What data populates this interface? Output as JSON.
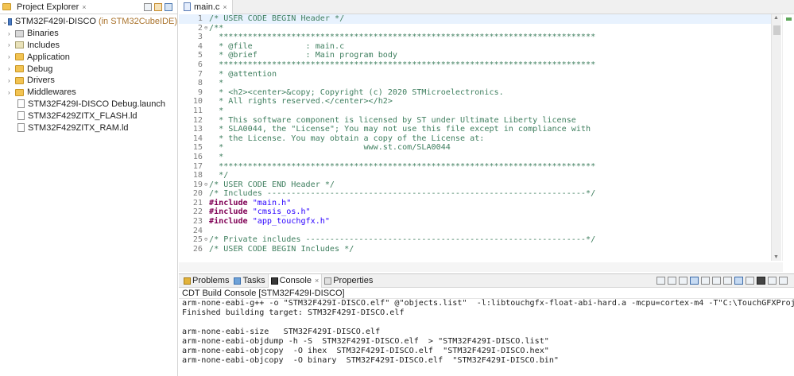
{
  "project_explorer": {
    "title": "Project Explorer",
    "close_glyph": "×",
    "project": {
      "name": "STM32F429I-DISCO",
      "hint": "(in STM32CubeIDE)"
    },
    "folders": [
      {
        "label": "Binaries",
        "icon": "binaries-icon"
      },
      {
        "label": "Includes",
        "icon": "includes-icon"
      },
      {
        "label": "Application",
        "icon": "folder-icon"
      },
      {
        "label": "Debug",
        "icon": "folder-icon"
      },
      {
        "label": "Drivers",
        "icon": "folder-icon"
      },
      {
        "label": "Middlewares",
        "icon": "folder-icon"
      }
    ],
    "files": [
      {
        "label": "STM32F429I-DISCO Debug.launch"
      },
      {
        "label": "STM32F429ZITX_FLASH.ld"
      },
      {
        "label": "STM32F429ZITX_RAM.ld"
      }
    ]
  },
  "editor": {
    "tab_label": "main.c",
    "lines": [
      {
        "num": "1",
        "fold": "",
        "text": "/* USER CODE BEGIN Header */"
      },
      {
        "num": "2",
        "fold": "⊖",
        "text": "/**"
      },
      {
        "num": "3",
        "fold": "",
        "text": "  ******************************************************************************"
      },
      {
        "num": "4",
        "fold": "",
        "text": "  * @file           : main.c"
      },
      {
        "num": "5",
        "fold": "",
        "text": "  * @brief          : Main program body"
      },
      {
        "num": "6",
        "fold": "",
        "text": "  ******************************************************************************"
      },
      {
        "num": "7",
        "fold": "",
        "text": "  * @attention"
      },
      {
        "num": "8",
        "fold": "",
        "text": "  *"
      },
      {
        "num": "9",
        "fold": "",
        "text": "  * <h2><center>&copy; Copyright (c) 2020 STMicroelectronics."
      },
      {
        "num": "10",
        "fold": "",
        "text": "  * All rights reserved.</center></h2>"
      },
      {
        "num": "11",
        "fold": "",
        "text": "  *"
      },
      {
        "num": "12",
        "fold": "",
        "text": "  * This software component is licensed by ST under Ultimate Liberty license"
      },
      {
        "num": "13",
        "fold": "",
        "text": "  * SLA0044, the \"License\"; You may not use this file except in compliance with"
      },
      {
        "num": "14",
        "fold": "",
        "text": "  * the License. You may obtain a copy of the License at:"
      },
      {
        "num": "15",
        "fold": "",
        "text": "  *                             www.st.com/SLA0044"
      },
      {
        "num": "16",
        "fold": "",
        "text": "  *"
      },
      {
        "num": "17",
        "fold": "",
        "text": "  ******************************************************************************"
      },
      {
        "num": "18",
        "fold": "",
        "text": "  */"
      },
      {
        "num": "19",
        "fold": "⊖",
        "text": "/* USER CODE END Header */"
      },
      {
        "num": "20",
        "fold": "",
        "text": "/* Includes ------------------------------------------------------------------*/"
      },
      {
        "num": "21",
        "fold": "",
        "kw": "#include",
        "str": "\"main.h\""
      },
      {
        "num": "22",
        "fold": "",
        "kw": "#include",
        "str": "\"cmsis_os.h\""
      },
      {
        "num": "23",
        "fold": "",
        "kw": "#include",
        "str": "\"app_touchgfx.h\""
      },
      {
        "num": "24",
        "fold": "",
        "text": ""
      },
      {
        "num": "25",
        "fold": "⊖",
        "text": "/* Private includes ----------------------------------------------------------*/"
      },
      {
        "num": "26",
        "fold": "",
        "text": "/* USER CODE BEGIN Includes */"
      }
    ]
  },
  "console": {
    "tabs": [
      {
        "label": "Problems",
        "icon": "problems-icon"
      },
      {
        "label": "Tasks",
        "icon": "tasks-icon"
      },
      {
        "label": "Console",
        "icon": "console-icon"
      },
      {
        "label": "Properties",
        "icon": "properties-icon"
      }
    ],
    "title": "CDT Build Console [STM32F429I-DISCO]",
    "lines": [
      "arm-none-eabi-g++ -o \"STM32F429I-DISCO.elf\" @\"objects.list\"  -l:libtouchgfx-float-abi-hard.a -mcpu=cortex-m4 -T\"C:\\TouchGFXProject",
      "Finished building target: STM32F429I-DISCO.elf",
      "",
      "arm-none-eabi-size   STM32F429I-DISCO.elf",
      "arm-none-eabi-objdump -h -S  STM32F429I-DISCO.elf  > \"STM32F429I-DISCO.list\"",
      "arm-none-eabi-objcopy  -O ihex  STM32F429I-DISCO.elf  \"STM32F429I-DISCO.hex\"",
      "arm-none-eabi-objcopy  -O binary  STM32F429I-DISCO.elf  \"STM32F429I-DISCO.bin\""
    ]
  }
}
